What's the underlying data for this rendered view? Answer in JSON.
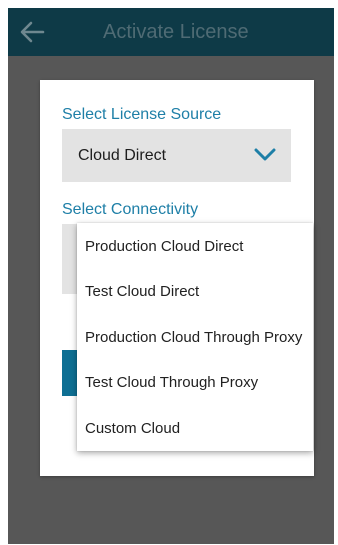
{
  "appbar": {
    "title": "Activate License",
    "back_icon": "arrow-left-icon"
  },
  "dialog": {
    "license_source": {
      "label": "Select License Source",
      "selected": "Cloud Direct",
      "dropdown_icon": "chevron-down-icon"
    },
    "connectivity": {
      "label": "Select Connectivity",
      "options": [
        "Production Cloud Direct",
        "Test Cloud Direct",
        "Production Cloud Through Proxy",
        "Test Cloud Through Proxy",
        "Custom Cloud"
      ]
    }
  },
  "colors": {
    "appbar_bg": "#0e3a47",
    "accent": "#1e7fa7",
    "button": "#0e6f93",
    "overlay": "#575757"
  }
}
